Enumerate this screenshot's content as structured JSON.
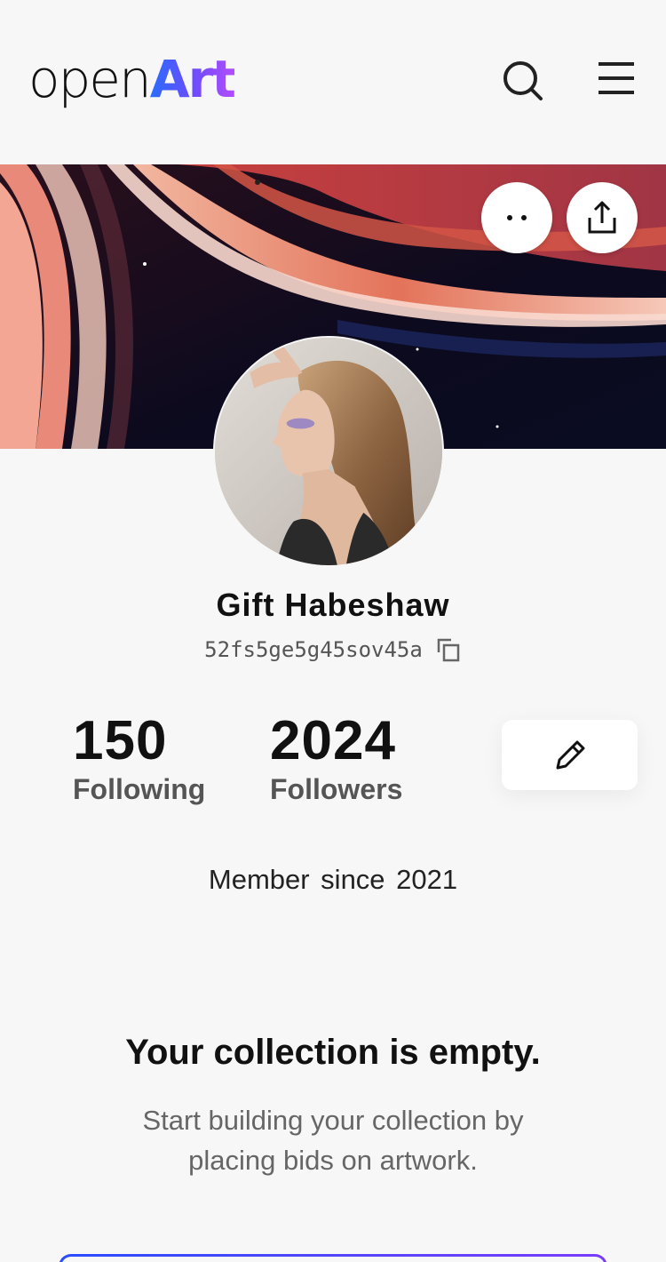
{
  "header": {
    "logo_open": "open",
    "logo_art": "Art",
    "search_icon": "search-icon",
    "menu_icon": "hamburger-menu-icon"
  },
  "banner": {
    "more_icon": "more-dots-icon",
    "share_icon": "share-upload-icon"
  },
  "profile": {
    "name": "Gift Habeshaw",
    "address": "52fs5ge5g45sov45a",
    "copy_icon": "copy-icon",
    "following_count": "150",
    "following_label": "Following",
    "followers_count": "2024",
    "followers_label": "Followers",
    "edit_icon": "pencil-icon",
    "member_since": "Member since  2021"
  },
  "collection": {
    "empty_title": "Your collection is empty.",
    "empty_desc": "Start building your collection by placing bids on artwork."
  },
  "colors": {
    "brand_gradient_start": "#2a6cff",
    "brand_gradient_end": "#b34cff",
    "background": "#f7f7f7"
  }
}
